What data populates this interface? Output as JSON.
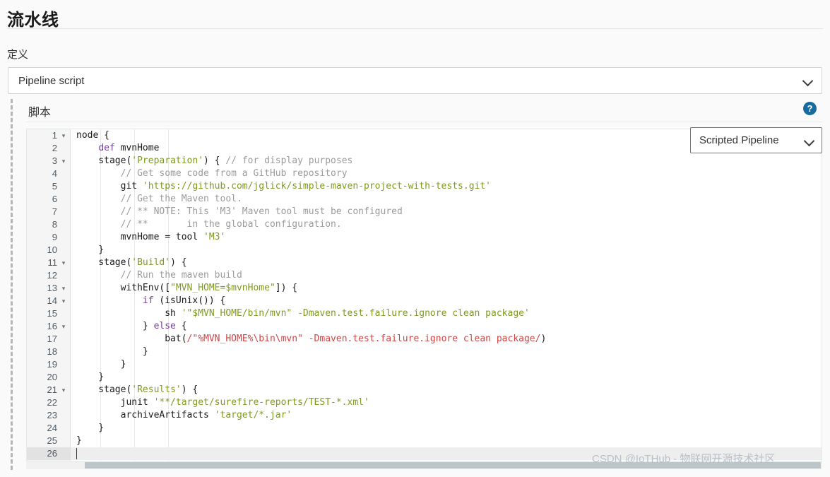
{
  "page": {
    "title": "流水线",
    "definition_label": "定义",
    "script_label": "脚本",
    "help_icon_glyph": "?",
    "watermark": "CSDN @IoTHub - 物联网开源技术社区"
  },
  "definition_select": {
    "value": "Pipeline script",
    "chevron": "chevron-down-icon"
  },
  "mode_select": {
    "value": "Scripted Pipeline",
    "chevron": "chevron-down-icon"
  },
  "colors": {
    "accent_help": "#1a6aa2",
    "keyword": "#7a3e9d",
    "string": "#7f9a21",
    "comment": "#9b9b9b",
    "regex": "#d14545",
    "gutter_bg": "#f5f5f5",
    "active_line": "#eeeeee"
  },
  "editor": {
    "active_line": 26,
    "total_lines": 26,
    "fold_lines": [
      1,
      3,
      11,
      13,
      14,
      16,
      21
    ],
    "line_numbers": [
      "1",
      "2",
      "3",
      "4",
      "5",
      "6",
      "7",
      "8",
      "9",
      "10",
      "11",
      "12",
      "13",
      "14",
      "15",
      "16",
      "17",
      "18",
      "19",
      "20",
      "21",
      "22",
      "23",
      "24",
      "25",
      "26"
    ],
    "lines": [
      {
        "n": 1,
        "tokens": [
          {
            "t": "pln",
            "v": "node {"
          }
        ]
      },
      {
        "n": 2,
        "tokens": [
          {
            "t": "pln",
            "v": "    "
          },
          {
            "t": "kw",
            "v": "def"
          },
          {
            "t": "pln",
            "v": " mvnHome"
          }
        ]
      },
      {
        "n": 3,
        "tokens": [
          {
            "t": "pln",
            "v": "    stage("
          },
          {
            "t": "str",
            "v": "'Preparation'"
          },
          {
            "t": "pln",
            "v": ") { "
          },
          {
            "t": "com",
            "v": "// for display purposes"
          }
        ]
      },
      {
        "n": 4,
        "tokens": [
          {
            "t": "pln",
            "v": "        "
          },
          {
            "t": "com",
            "v": "// Get some code from a GitHub repository"
          }
        ]
      },
      {
        "n": 5,
        "tokens": [
          {
            "t": "pln",
            "v": "        git "
          },
          {
            "t": "str",
            "v": "'https://github.com/jglick/simple-maven-project-with-tests.git'"
          }
        ]
      },
      {
        "n": 6,
        "tokens": [
          {
            "t": "pln",
            "v": "        "
          },
          {
            "t": "com",
            "v": "// Get the Maven tool."
          }
        ]
      },
      {
        "n": 7,
        "tokens": [
          {
            "t": "pln",
            "v": "        "
          },
          {
            "t": "com",
            "v": "// ** NOTE: This 'M3' Maven tool must be configured"
          }
        ]
      },
      {
        "n": 8,
        "tokens": [
          {
            "t": "pln",
            "v": "        "
          },
          {
            "t": "com",
            "v": "// **       in the global configuration."
          }
        ]
      },
      {
        "n": 9,
        "tokens": [
          {
            "t": "pln",
            "v": "        mvnHome = tool "
          },
          {
            "t": "str",
            "v": "'M3'"
          }
        ]
      },
      {
        "n": 10,
        "tokens": [
          {
            "t": "pln",
            "v": "    }"
          }
        ]
      },
      {
        "n": 11,
        "tokens": [
          {
            "t": "pln",
            "v": "    stage("
          },
          {
            "t": "str",
            "v": "'Build'"
          },
          {
            "t": "pln",
            "v": ") {"
          }
        ]
      },
      {
        "n": 12,
        "tokens": [
          {
            "t": "pln",
            "v": "        "
          },
          {
            "t": "com",
            "v": "// Run the maven build"
          }
        ]
      },
      {
        "n": 13,
        "tokens": [
          {
            "t": "pln",
            "v": "        withEnv(["
          },
          {
            "t": "str",
            "v": "\"MVN_HOME=$mvnHome\""
          },
          {
            "t": "pln",
            "v": "]) {"
          }
        ]
      },
      {
        "n": 14,
        "tokens": [
          {
            "t": "pln",
            "v": "            "
          },
          {
            "t": "kw",
            "v": "if"
          },
          {
            "t": "pln",
            "v": " (isUnix()) {"
          }
        ]
      },
      {
        "n": 15,
        "tokens": [
          {
            "t": "pln",
            "v": "                sh "
          },
          {
            "t": "str",
            "v": "'\"$MVN_HOME/bin/mvn\" -Dmaven.test.failure.ignore clean package'"
          }
        ]
      },
      {
        "n": 16,
        "tokens": [
          {
            "t": "pln",
            "v": "            } "
          },
          {
            "t": "kw",
            "v": "else"
          },
          {
            "t": "pln",
            "v": " {"
          }
        ]
      },
      {
        "n": 17,
        "tokens": [
          {
            "t": "pln",
            "v": "                bat("
          },
          {
            "t": "rgx",
            "v": "/\"%MVN_HOME%\\bin\\mvn\" -Dmaven.test.failure.ignore clean package/"
          },
          {
            "t": "pln",
            "v": ")"
          }
        ]
      },
      {
        "n": 18,
        "tokens": [
          {
            "t": "pln",
            "v": "            }"
          }
        ]
      },
      {
        "n": 19,
        "tokens": [
          {
            "t": "pln",
            "v": "        }"
          }
        ]
      },
      {
        "n": 20,
        "tokens": [
          {
            "t": "pln",
            "v": "    }"
          }
        ]
      },
      {
        "n": 21,
        "tokens": [
          {
            "t": "pln",
            "v": "    stage("
          },
          {
            "t": "str",
            "v": "'Results'"
          },
          {
            "t": "pln",
            "v": ") {"
          }
        ]
      },
      {
        "n": 22,
        "tokens": [
          {
            "t": "pln",
            "v": "        junit "
          },
          {
            "t": "str",
            "v": "'**/target/surefire-reports/TEST-*.xml'"
          }
        ]
      },
      {
        "n": 23,
        "tokens": [
          {
            "t": "pln",
            "v": "        archiveArtifacts "
          },
          {
            "t": "str",
            "v": "'target/*.jar'"
          }
        ]
      },
      {
        "n": 24,
        "tokens": [
          {
            "t": "pln",
            "v": "    }"
          }
        ]
      },
      {
        "n": 25,
        "tokens": [
          {
            "t": "pln",
            "v": "}"
          }
        ]
      },
      {
        "n": 26,
        "tokens": [
          {
            "t": "pln",
            "v": ""
          }
        ]
      }
    ]
  }
}
